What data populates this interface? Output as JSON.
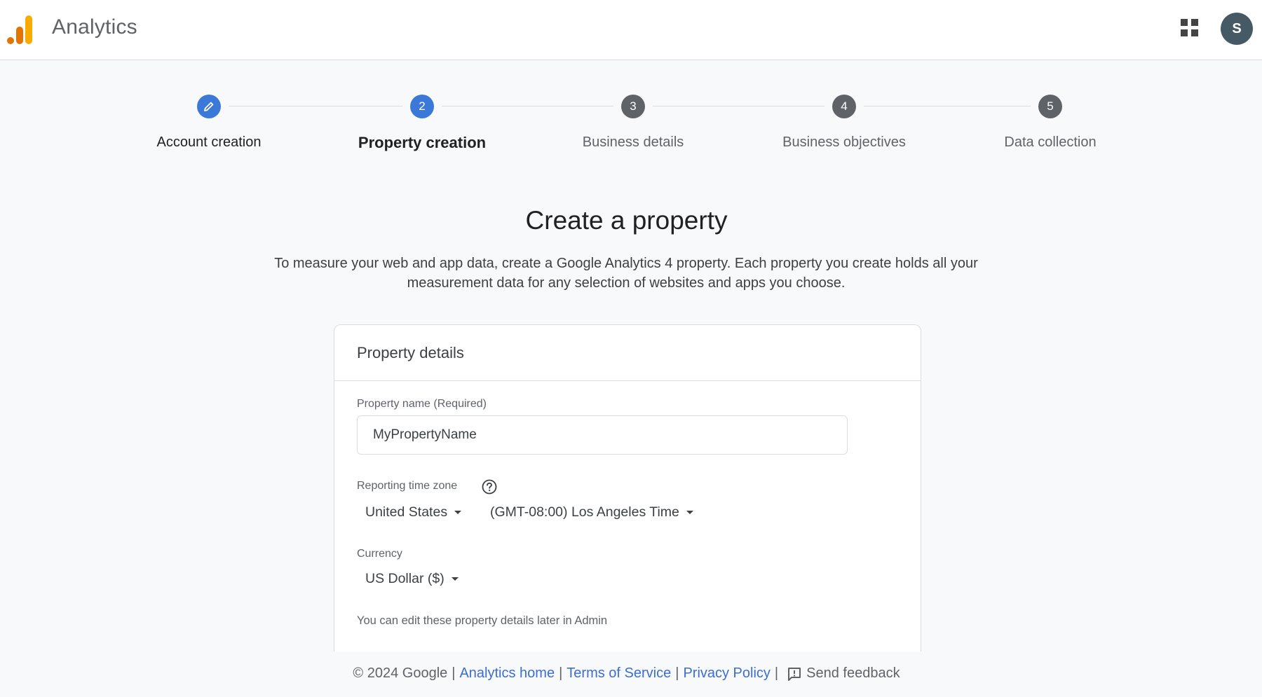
{
  "header": {
    "app_title": "Analytics",
    "logo_icon": "analytics-logo-icon",
    "apps_icon": "apps-grid-icon",
    "avatar_initial": "S",
    "colors": {
      "logo_dark": "#e37400",
      "logo_light": "#f9ab00",
      "avatar_bg": "#455a64"
    }
  },
  "stepper": {
    "steps": [
      {
        "number": "1",
        "label": "Account creation",
        "state": "done",
        "icon": "pencil-icon"
      },
      {
        "number": "2",
        "label": "Property creation",
        "state": "active"
      },
      {
        "number": "3",
        "label": "Business details",
        "state": "pending"
      },
      {
        "number": "4",
        "label": "Business objectives",
        "state": "pending"
      },
      {
        "number": "5",
        "label": "Data collection",
        "state": "pending"
      }
    ],
    "colors": {
      "active": "#3c78d8",
      "pending": "#5f6368"
    }
  },
  "main": {
    "title": "Create a property",
    "description": "To measure your web and app data, create a Google Analytics 4 property. Each property you create holds all your measurement data for any selection of websites and apps you choose."
  },
  "card": {
    "title": "Property details",
    "property_name": {
      "label": "Property name (Required)",
      "value": "MyPropertyName"
    },
    "time_zone": {
      "label": "Reporting time zone",
      "help_icon": "help-circle-icon",
      "country": "United States",
      "zone": "(GMT-08:00) Los Angeles Time"
    },
    "currency": {
      "label": "Currency",
      "value": "US Dollar ($)"
    },
    "note": "You can edit these property details later in Admin"
  },
  "footer": {
    "copyright": "© 2024 Google",
    "links": [
      "Analytics home",
      "Terms of Service",
      "Privacy Policy"
    ],
    "separator": "|",
    "feedback_label": "Send feedback",
    "link_color": "#3c6dd1"
  }
}
